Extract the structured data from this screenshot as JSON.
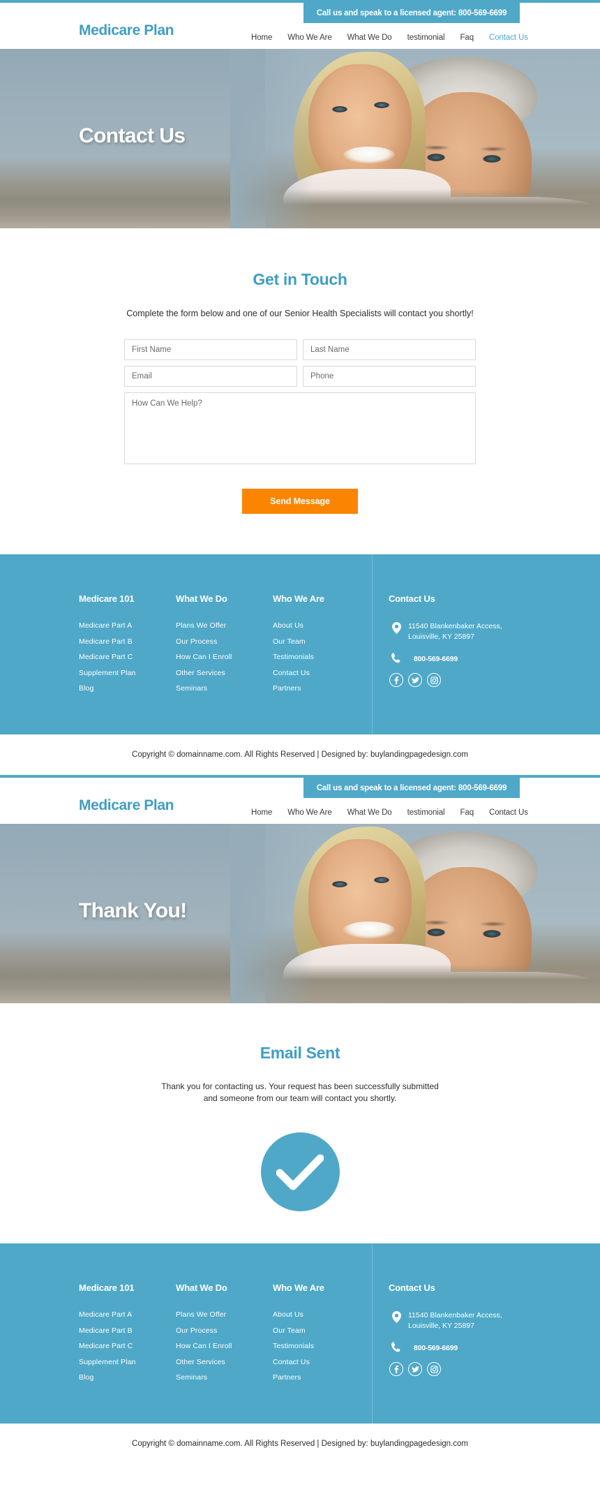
{
  "theme": {
    "accent_blue": "#4fa8c8",
    "brand_blue": "#3f9ec4",
    "button_orange": "#fb8500",
    "text_dark": "#2c2c2c"
  },
  "header": {
    "call_banner": "Call us and speak to a licensed agent: 800-569-6699",
    "brand": "Medicare Plan",
    "nav": [
      {
        "label": "Home",
        "active": false
      },
      {
        "label": "Who We Are",
        "active": false
      },
      {
        "label": "What We Do",
        "active": false
      },
      {
        "label": "testimonial",
        "active": false
      },
      {
        "label": "Faq",
        "active": false
      },
      {
        "label": "Contact Us",
        "active": true
      }
    ]
  },
  "hero": {
    "title": "Contact Us"
  },
  "form_section": {
    "title": "Get in Touch",
    "subtitle": "Complete the form below and one of our Senior Health Specialists will contact you shortly!",
    "fields": {
      "first_name_placeholder": "First Name",
      "last_name_placeholder": "Last Name",
      "email_placeholder": "Email",
      "phone_placeholder": "Phone",
      "message_placeholder": "How Can We Help?",
      "first_name_value": "",
      "last_name_value": "",
      "email_value": "",
      "phone_value": "",
      "message_value": ""
    },
    "submit_label": "Send Message"
  },
  "footer": {
    "columns": [
      {
        "heading": "Medicare 101",
        "links": [
          "Medicare Part A",
          "Medicare Part B",
          "Medicare Part C",
          "Supplement Plan",
          "Blog"
        ]
      },
      {
        "heading": "What We Do",
        "links": [
          "Plans We Offer",
          "Our Process",
          "How Can I Enroll",
          "Other Services",
          "Seminars"
        ]
      },
      {
        "heading": "Who We Are",
        "links": [
          "About Us",
          "Our Team",
          "Testimonials",
          "Contact Us",
          "Partners"
        ]
      }
    ],
    "contact": {
      "heading": "Contact Us",
      "address_line1": "11540 Blankenbaker Access,",
      "address_line2": "Louisville, KY 25897",
      "phone": "800-569-6699",
      "socials": [
        "facebook-icon",
        "twitter-icon",
        "instagram-icon"
      ]
    }
  },
  "copyright": {
    "text": "Copyright © domainname.com. All Rights Reserved | Designed by: buylandingpagedesign.com"
  },
  "thankyou_page": {
    "header": {
      "call_banner": "Call us and speak to a licensed agent: 800-569-6699",
      "brand": "Medicare Plan",
      "nav": [
        {
          "label": "Home",
          "active": false
        },
        {
          "label": "Who We Are",
          "active": false
        },
        {
          "label": "What We Do",
          "active": false
        },
        {
          "label": "testimonial",
          "active": false
        },
        {
          "label": "Faq",
          "active": false
        },
        {
          "label": "Contact Us",
          "active": false
        }
      ]
    },
    "hero_title": "Thank You!",
    "title": "Email Sent",
    "message_line1": "Thank you for contacting us. Your request has been successfully submitted",
    "message_line2": "and someone from our team will contact you shortly.",
    "icon": "check-circle-icon"
  }
}
